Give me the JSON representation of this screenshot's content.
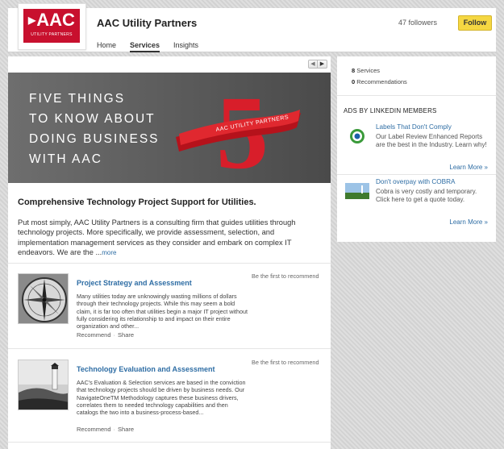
{
  "company": {
    "name": "AAC Utility Partners",
    "logo_text": "AAC",
    "logo_subtext": "UTILITY PARTNERS",
    "followers": "47 followers",
    "follow_label": "Follow"
  },
  "tabs": [
    {
      "label": "Home",
      "active": false
    },
    {
      "label": "Services",
      "active": true
    },
    {
      "label": "Insights",
      "active": false
    }
  ],
  "banner": {
    "lines": [
      "FIVE THINGS",
      "TO KNOW ABOUT",
      "DOING BUSINESS",
      "WITH AAC"
    ],
    "number": "5",
    "ribbon_text": "AAC UTILITY PARTNERS"
  },
  "description": {
    "title": "Comprehensive Technology Project Support for Utilities.",
    "body": "Put most simply, AAC Utility Partners is a consulting firm that guides utilities through technology projects. More specifically, we provide assessment, selection, and implementation management services as they consider and embark on complex IT endeavors. We are the ...",
    "more_label": "more"
  },
  "services": [
    {
      "title": "Project Strategy and Assessment",
      "recommend_first": "Be the first to recommend",
      "text": "Many utilities today are unknowingly wasting millions of dollars through their technology projects.  While this may seem a bold claim, it is far too often that utilities begin a major IT project without fully considering its relationship to and impact on their entire organization and other...",
      "recommend_label": "Recommend",
      "share_label": "Share"
    },
    {
      "title": "Technology Evaluation and Assessment",
      "recommend_first": "Be the first to recommend",
      "text": "AAC's Evaluation & Selection services are based in the conviction that technology projects should be driven by business needs. Our NavigateOneTM Methodology captures these business drivers, correlates them to needed technology capabilities and then catalogs the two into a business-process-based...",
      "recommend_label": "Recommend",
      "share_label": "Share"
    }
  ],
  "sidebar": {
    "services_count": "8",
    "services_label": "Services",
    "recommendations_count": "0",
    "recommendations_label": "Recommendations",
    "ads_heading": "ADS BY LINKEDIN MEMBERS",
    "ads": [
      {
        "title": "Labels That Don't Comply",
        "body": "Our Label Review Enhanced Reports are the best in the Industry. Learn why!",
        "learn_more": "Learn More »",
        "icon": "target-icon"
      },
      {
        "title": "Don't overpay with COBRA",
        "body": "Cobra is very costly and temporary. Click here to get a quote today.",
        "learn_more": "Learn More »",
        "icon": "landscape-icon"
      }
    ]
  },
  "colors": {
    "brand_red": "#c8102e",
    "link_blue": "#2e6da4",
    "follow_yellow": "#f5d742"
  }
}
